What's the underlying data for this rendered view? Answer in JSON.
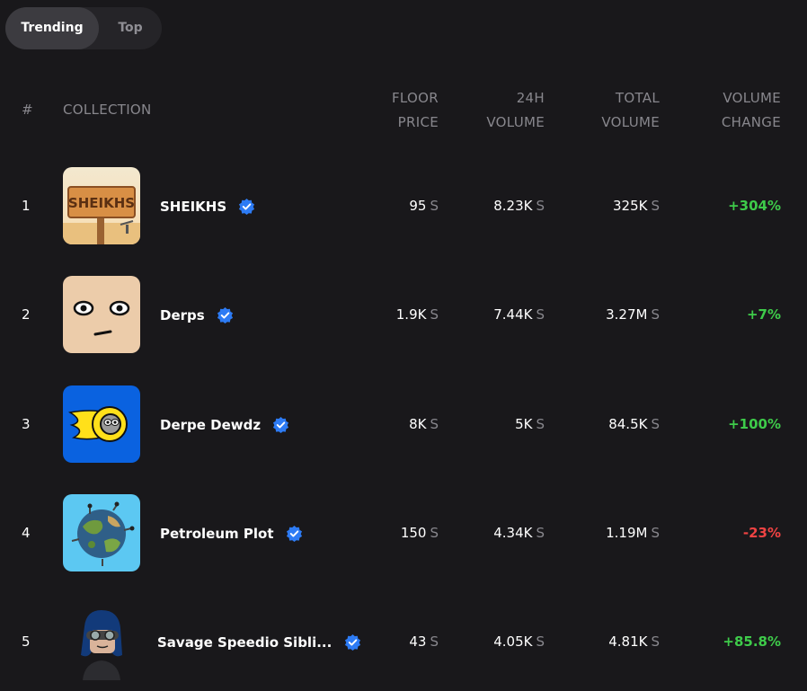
{
  "tabs": [
    {
      "label": "Trending",
      "active": true
    },
    {
      "label": "Top",
      "active": false
    }
  ],
  "columns": {
    "rank": "#",
    "collection": "COLLECTION",
    "floor_price": [
      "FLOOR",
      "PRICE"
    ],
    "volume_24h": [
      "24H",
      "VOLUME"
    ],
    "total_volume": [
      "TOTAL",
      "VOLUME"
    ],
    "volume_change": [
      "VOLUME",
      "CHANGE"
    ]
  },
  "currency_unit": "S",
  "rows": [
    {
      "rank": "1",
      "name": "SHEIKHS",
      "verified": true,
      "floor": "95",
      "vol24h": "8.23K",
      "total": "325K",
      "change": "+304%",
      "thumb_text": "SHEIKHS"
    },
    {
      "rank": "2",
      "name": "Derps",
      "verified": true,
      "floor": "1.9K",
      "vol24h": "7.44K",
      "total": "3.27M",
      "change": "+7%"
    },
    {
      "rank": "3",
      "name": "Derpe Dewdz",
      "verified": true,
      "floor": "8K",
      "vol24h": "5K",
      "total": "84.5K",
      "change": "+100%"
    },
    {
      "rank": "4",
      "name": "Petroleum Plot",
      "verified": true,
      "floor": "150",
      "vol24h": "4.34K",
      "total": "1.19M",
      "change": "-23%"
    },
    {
      "rank": "5",
      "name": "Savage Speedio Sibli...",
      "verified": true,
      "floor": "43",
      "vol24h": "4.05K",
      "total": "4.81K",
      "change": "+85.8%"
    }
  ],
  "colors": {
    "background": "#19181b",
    "positive": "#3ecb4a",
    "negative": "#f04343",
    "verified": "#2d7bf4",
    "muted": "#88878d"
  }
}
